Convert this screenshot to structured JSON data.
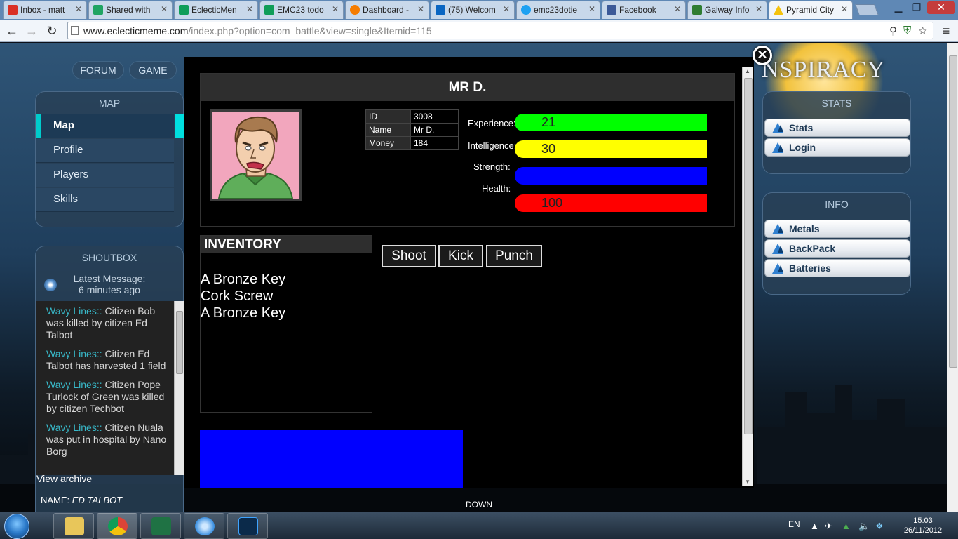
{
  "browser": {
    "tabs": [
      {
        "title": "Inbox - matt",
        "color": "#d93025"
      },
      {
        "title": "Shared with",
        "color": "#1fa463"
      },
      {
        "title": "EclecticMen",
        "color": "#0f9d58"
      },
      {
        "title": "EMC23 todo",
        "color": "#0f9d58"
      },
      {
        "title": "Dashboard -",
        "color": "#f57c00"
      },
      {
        "title": "(75) Welcom",
        "color": "#0a66c2"
      },
      {
        "title": "emc23dotie",
        "color": "#1da1f2"
      },
      {
        "title": "Facebook",
        "color": "#3b5998"
      },
      {
        "title": "Galway Info",
        "color": "#2e7d32"
      },
      {
        "title": "Pyramid City",
        "color": "#f4c20d"
      }
    ],
    "url_host": "www.eclecticmeme.com",
    "url_path": "/index.php?option=com_battle&view=single&Itemid=115"
  },
  "nav": {
    "forum": "FORUM",
    "game": "GAME"
  },
  "logo_text": "NSPIRACY",
  "map_panel": {
    "title": "MAP",
    "items": [
      "Map",
      "Profile",
      "Players",
      "Skills"
    ]
  },
  "shoutbox": {
    "title": "SHOUTBOX",
    "latest": "Latest Message:",
    "latest_time": "6 minutes ago",
    "messages": [
      {
        "who": "Wavy Lines::",
        "text": " Citizen Bob was killed by citizen Ed Talbot"
      },
      {
        "who": "Wavy Lines::",
        "text": " Citizen Ed Talbot has harvested 1 field"
      },
      {
        "who": "Wavy Lines::",
        "text": " Citizen Pope Turlock of Green was killed by citizen Techbot"
      },
      {
        "who": "Wavy Lines::",
        "text": " Citizen Nuala was put in hospital by Nano Borg"
      }
    ],
    "view_archive": "View archive",
    "name_label": "NAME:",
    "name_value": "ED TALBOT"
  },
  "stats_panel": {
    "title": "STATS",
    "items": [
      "Stats",
      "Login"
    ]
  },
  "info_panel": {
    "title": "INFO",
    "items": [
      "Metals",
      "BackPack",
      "Batteries"
    ]
  },
  "down_label": "DOWN",
  "character": {
    "name": "MR D.",
    "fields": [
      {
        "key": "ID",
        "value": "3008"
      },
      {
        "key": "Name",
        "value": "Mr D."
      },
      {
        "key": "Money",
        "value": "184"
      }
    ],
    "stats": [
      {
        "label": "Experience:",
        "value": "21",
        "color": "#00ff00"
      },
      {
        "label": "Intelligence:",
        "value": "30",
        "color": "#ffff00"
      },
      {
        "label": "Strength:",
        "value": "",
        "color": "#0000ff"
      },
      {
        "label": "Health:",
        "value": "100",
        "color": "#ff0000"
      }
    ]
  },
  "inventory": {
    "title": "INVENTORY",
    "items": [
      "A Bronze Key",
      "Cork Screw",
      "A Bronze Key"
    ]
  },
  "actions": [
    "Shoot",
    "Kick",
    "Punch"
  ],
  "taskbar": {
    "lang": "EN",
    "time": "15:03",
    "date": "26/11/2012"
  }
}
